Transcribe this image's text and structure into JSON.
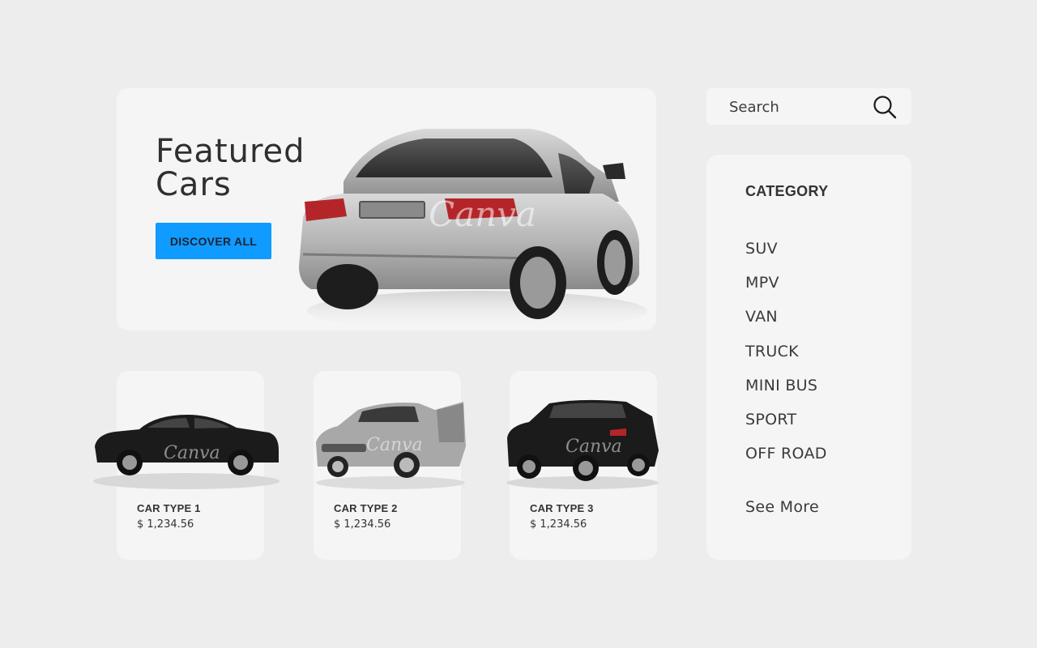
{
  "hero": {
    "title": "Featured Cars",
    "button_label": "DISCOVER ALL",
    "watermark": "Canva"
  },
  "products": [
    {
      "name": "CAR TYPE 1",
      "price": "$ 1,234.56",
      "watermark": "Canva"
    },
    {
      "name": "CAR TYPE 2",
      "price": "$ 1,234.56",
      "watermark": "Canva"
    },
    {
      "name": "CAR TYPE 3",
      "price": "$ 1,234.56",
      "watermark": "Canva"
    }
  ],
  "search": {
    "placeholder": "Search",
    "value": ""
  },
  "category": {
    "heading": "CATEGORY",
    "items": [
      "SUV",
      "MPV",
      "VAN",
      "TRUCK",
      "MINI BUS",
      "SPORT",
      "OFF ROAD"
    ],
    "see_more": "See More"
  },
  "colors": {
    "page_bg": "#ededed",
    "card_bg": "#f5f5f5",
    "accent": "#0f9bff",
    "text": "#333333"
  },
  "icons": {
    "search": "search-icon"
  }
}
